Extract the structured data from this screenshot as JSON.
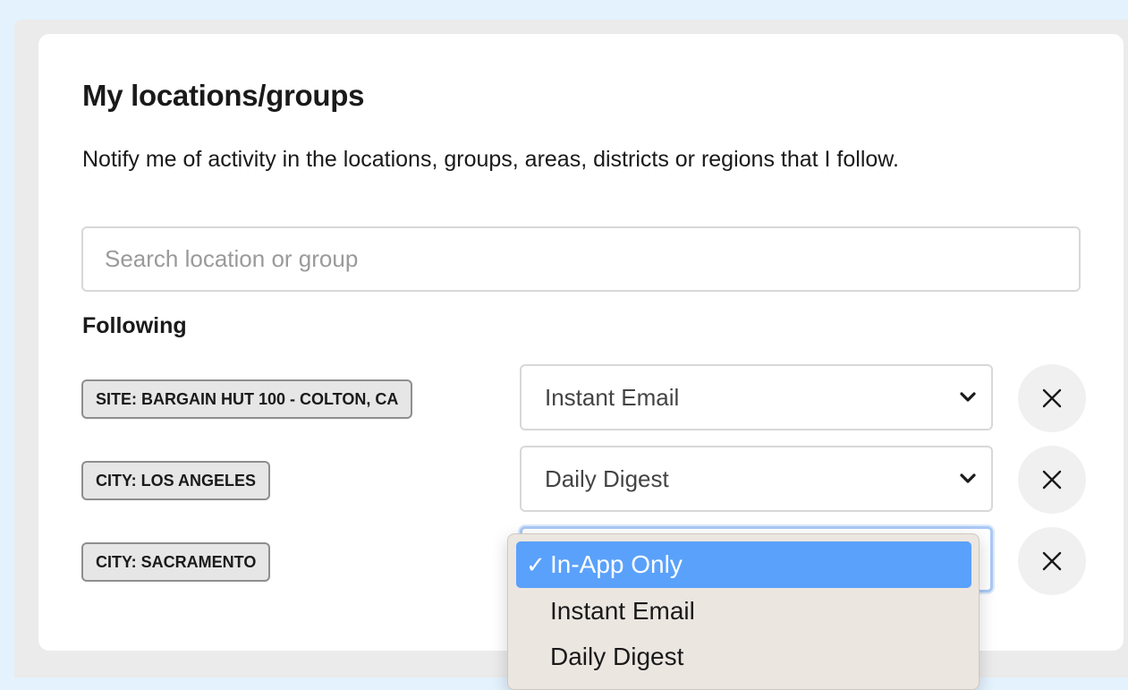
{
  "section": {
    "title": "My locations/groups",
    "description": "Notify me of activity in the locations, groups, areas, districts or regions that I follow."
  },
  "search": {
    "placeholder": "Search location or group",
    "value": ""
  },
  "following": {
    "label": "Following",
    "items": [
      {
        "chip": "SITE: BARGAIN HUT 100 - COLTON, CA",
        "notify": "Instant Email"
      },
      {
        "chip": "CITY: LOS ANGELES",
        "notify": "Daily Digest"
      },
      {
        "chip": "CITY: SACRAMENTO",
        "notify": "In-App Only"
      }
    ]
  },
  "dropdown": {
    "options": [
      "In-App Only",
      "Instant Email",
      "Daily Digest"
    ],
    "selected": "In-App Only",
    "check_glyph": "✓"
  },
  "icons": {
    "chevron": "chevron-down-icon",
    "remove": "close-icon"
  },
  "colors": {
    "page_background": "#e3f2fd",
    "panel_background": "#ebebeb",
    "selected_option": "#5aa1fb",
    "dropdown_background": "#ece6e1"
  }
}
